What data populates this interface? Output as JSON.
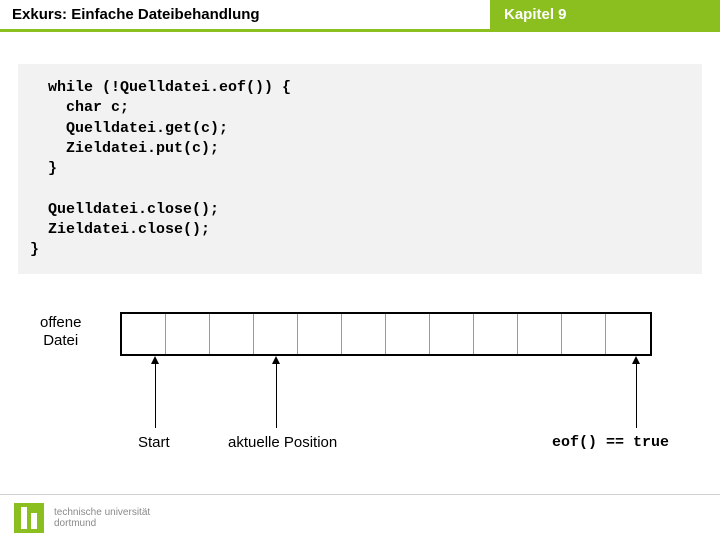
{
  "header": {
    "title": "Exkurs: Einfache Dateibehandlung",
    "chapter": "Kapitel 9"
  },
  "code": "  while (!Quelldatei.eof()) {\n    char c;\n    Quelldatei.get(c);\n    Zieldatei.put(c);\n  }\n\n  Quelldatei.close();\n  Zieldatei.close();\n}",
  "diagram": {
    "file_label_line1": "offene",
    "file_label_line2": "Datei",
    "start_label": "Start",
    "current_label": "aktuelle Position",
    "eof_label": "eof() == true",
    "cell_count": 12
  },
  "footer": {
    "uni_line1": "technische universität",
    "uni_line2": "dortmund"
  }
}
